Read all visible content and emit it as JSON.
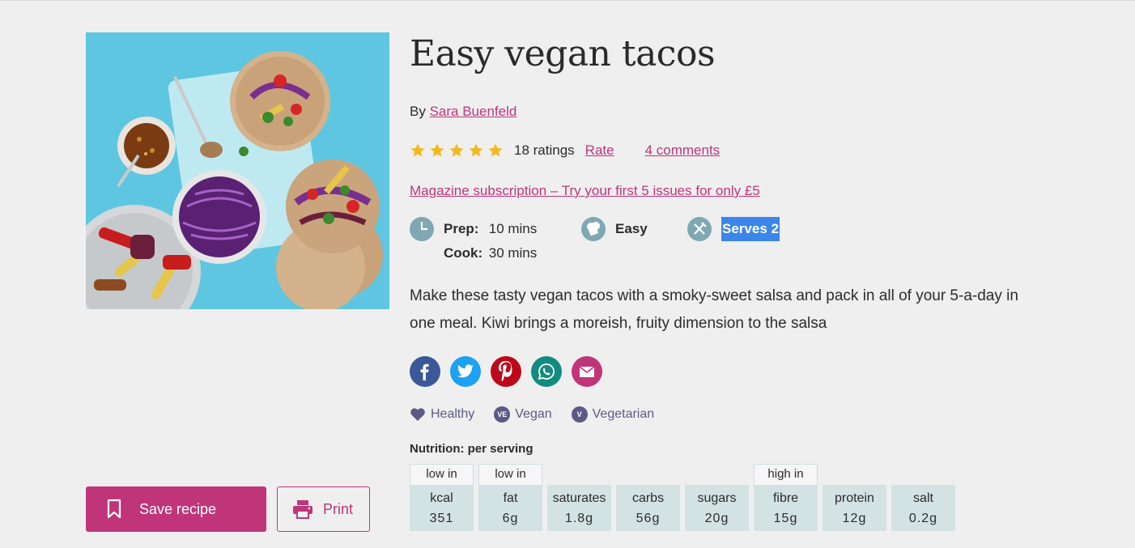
{
  "recipe": {
    "title": "Easy vegan tacos",
    "by_label": "By",
    "author": "Sara Buenfeld",
    "rating_stars": 5,
    "ratings_count": "18 ratings",
    "rate_label": "Rate",
    "comments_label": "4 comments",
    "promo_link": "Magazine subscription – Try your first 5 issues for only £5",
    "prep_label": "Prep:",
    "prep_value": "10 mins",
    "cook_label": "Cook:",
    "cook_value": "30 mins",
    "difficulty": "Easy",
    "serves": "Serves 2",
    "description": "Make these tasty vegan tacos with a smoky-sweet salsa and pack in all of your 5-a-day in one meal. Kiwi brings a moreish, fruity dimension to the salsa"
  },
  "actions": {
    "save_label": "Save recipe",
    "print_label": "Print"
  },
  "social": [
    {
      "name": "facebook",
      "color": "#3b5998"
    },
    {
      "name": "twitter",
      "color": "#1da1f2"
    },
    {
      "name": "pinterest",
      "color": "#bd081c"
    },
    {
      "name": "whatsapp",
      "color": "#128c7e"
    },
    {
      "name": "email",
      "color": "#c0357a"
    }
  ],
  "tags": [
    {
      "icon": "heart-icon",
      "label": "Healthy"
    },
    {
      "icon": "vegan-badge-icon",
      "badge": "VE",
      "label": "Vegan"
    },
    {
      "icon": "vegetarian-badge-icon",
      "badge": "V",
      "label": "Vegetarian"
    }
  ],
  "nutrition": {
    "title": "Nutrition: per serving",
    "items": [
      {
        "note": "low in",
        "name": "kcal",
        "value": "351"
      },
      {
        "note": "low in",
        "name": "fat",
        "value": "6g"
      },
      {
        "note": "",
        "name": "saturates",
        "value": "1.8g"
      },
      {
        "note": "",
        "name": "carbs",
        "value": "56g"
      },
      {
        "note": "",
        "name": "sugars",
        "value": "20g"
      },
      {
        "note": "high in",
        "name": "fibre",
        "value": "15g"
      },
      {
        "note": "",
        "name": "protein",
        "value": "12g"
      },
      {
        "note": "",
        "name": "salt",
        "value": "0.2g"
      }
    ]
  },
  "colors": {
    "brand_pink": "#c0357a",
    "meta_icon": "#7fa8b3",
    "tag_purple": "#5c5a85",
    "nutrition_bg": "#d3e2e3",
    "star": "#f3b91e",
    "selection": "#3b86e8"
  }
}
